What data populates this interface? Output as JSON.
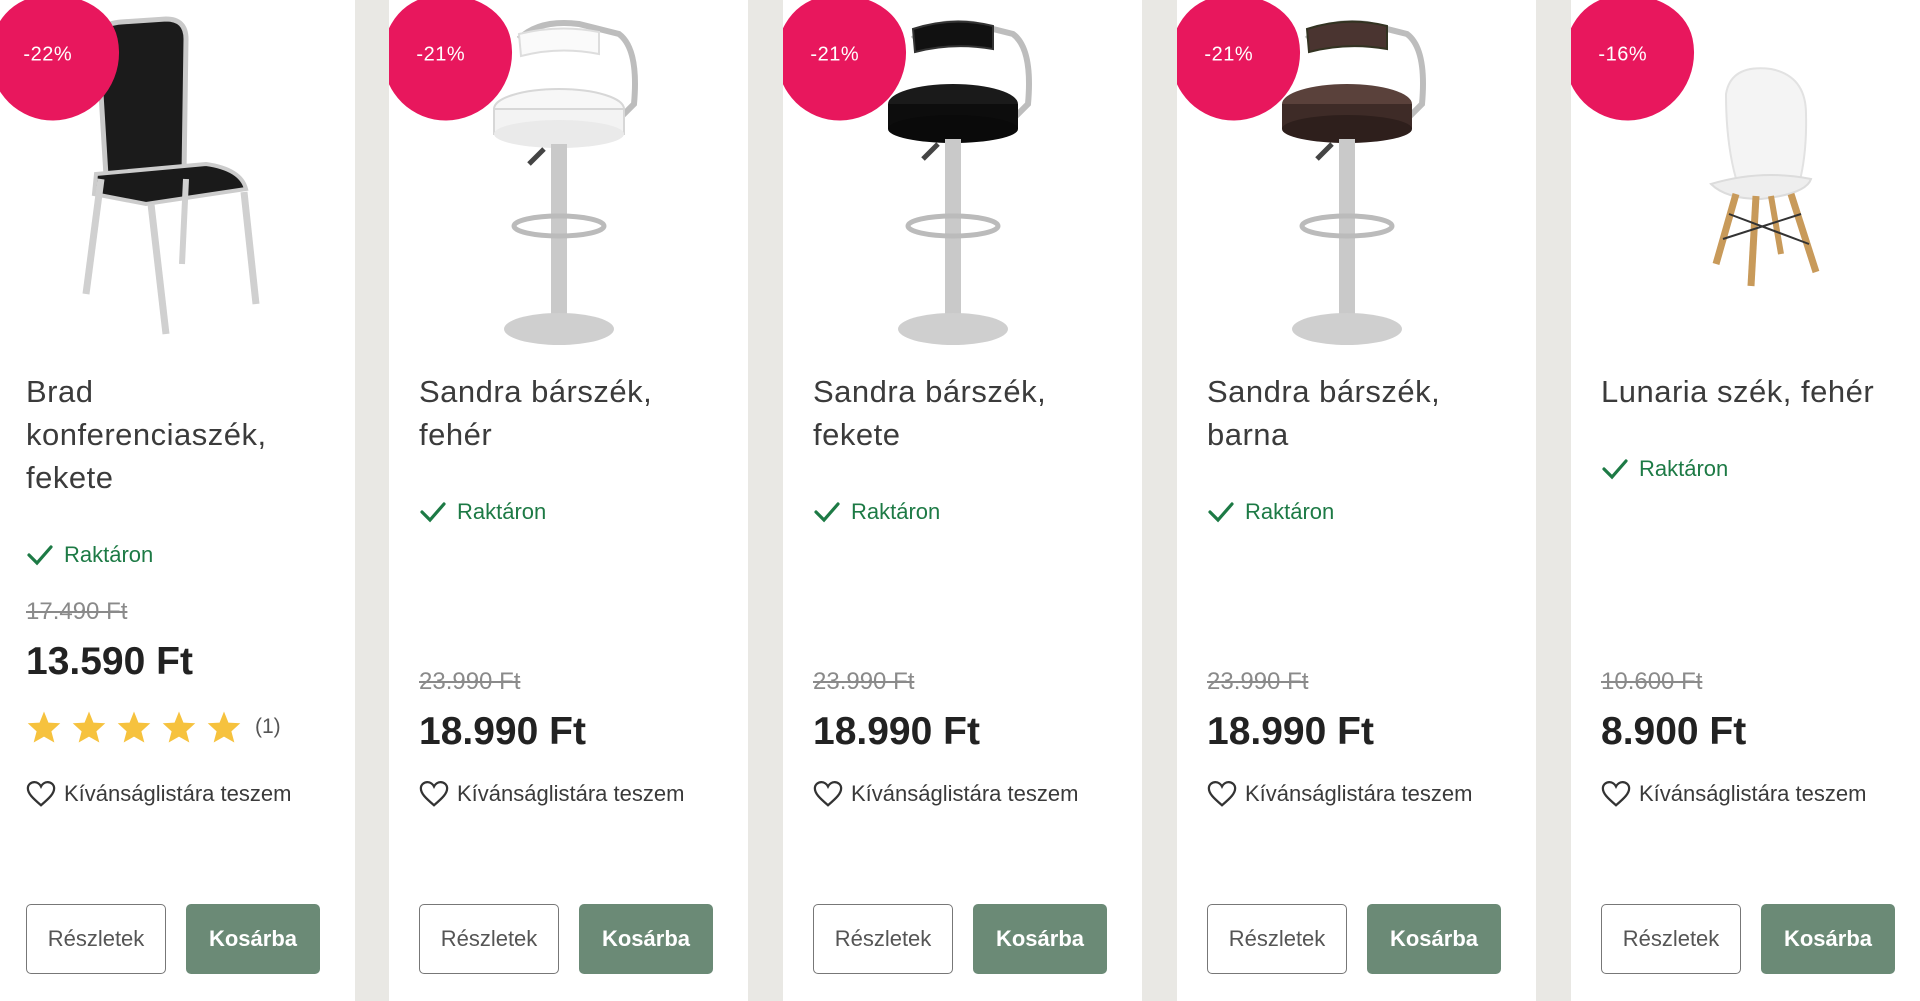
{
  "products": [
    {
      "discount": "-22%",
      "title_lines": [
        "Brad",
        "konferenciaszék,",
        "fekete"
      ],
      "stock": "Raktáron",
      "old_price": "17.490 Ft",
      "price": "13.590 Ft",
      "rating": {
        "stars": 5,
        "count": "(1)"
      },
      "wishlist": "Kívánságlistára teszem",
      "details_label": "Részletek",
      "cart_label": "Kosárba"
    },
    {
      "discount": "-21%",
      "title_lines": [
        "Sandra bárszék,",
        "fehér"
      ],
      "stock": "Raktáron",
      "old_price": "23.990 Ft",
      "price": "18.990 Ft",
      "wishlist": "Kívánságlistára teszem",
      "details_label": "Részletek",
      "cart_label": "Kosárba"
    },
    {
      "discount": "-21%",
      "title_lines": [
        "Sandra bárszék,",
        "fekete"
      ],
      "stock": "Raktáron",
      "old_price": "23.990 Ft",
      "price": "18.990 Ft",
      "wishlist": "Kívánságlistára teszem",
      "details_label": "Részletek",
      "cart_label": "Kosárba"
    },
    {
      "discount": "-21%",
      "title_lines": [
        "Sandra bárszék,",
        "barna"
      ],
      "stock": "Raktáron",
      "old_price": "23.990 Ft",
      "price": "18.990 Ft",
      "wishlist": "Kívánságlistára teszem",
      "details_label": "Részletek",
      "cart_label": "Kosárba"
    },
    {
      "discount": "-16%",
      "title_lines": [
        "Lunaria szék, fehér"
      ],
      "stock": "Raktáron",
      "old_price": "10.600 Ft",
      "price": "8.900 Ft",
      "wishlist": "Kívánságlistára teszem",
      "details_label": "Részletek",
      "cart_label": "Kosárba"
    }
  ],
  "colors": {
    "badge": "#e8175d",
    "stock": "#1d7a45",
    "cart_button": "#6b8a76",
    "star": "#f6c23e",
    "background": "#e9e8e4"
  },
  "icons": {
    "stock": "checkmark-icon",
    "wishlist": "heart-icon",
    "rating": "star-icon"
  }
}
